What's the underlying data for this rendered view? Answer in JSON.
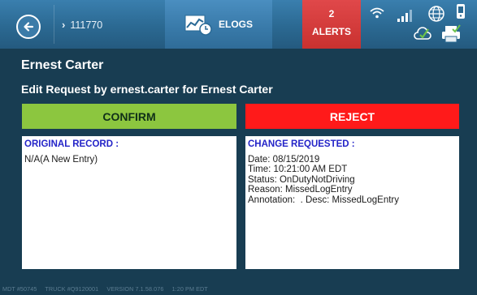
{
  "topbar": {
    "vehicle_id": "111770",
    "elogs_label": "ELOGS",
    "alerts_count": "2",
    "alerts_label": "ALERTS"
  },
  "page": {
    "driver_name": "Ernest Carter",
    "subtitle": "Edit Request by ernest.carter for Ernest Carter"
  },
  "actions": {
    "confirm_label": "CONFIRM",
    "reject_label": "REJECT"
  },
  "original": {
    "title": "ORIGINAL RECORD :",
    "lines": [
      "N/A(A New Entry)"
    ]
  },
  "change": {
    "title": "CHANGE REQUESTED :",
    "lines": [
      "Date: 08/15/2019",
      "Time: 10:21:00 AM EDT",
      "Status: OnDutyNotDriving",
      "Reason: MissedLogEntry",
      "Annotation:  . Desc: MissedLogEntry"
    ]
  },
  "footer": {
    "mdt": "MDT #50745",
    "truck": "TRUCK #Q9120001",
    "version": "VERSION  7.1.58.076",
    "time": "1:20 PM EDT"
  },
  "colors": {
    "background": "#183d52",
    "topbar": "#2b6992",
    "confirm": "#8cc63f",
    "reject": "#ff1a1a",
    "alerts": "#d23a3a",
    "panel_title": "#2424c8"
  },
  "icons": [
    "back-arrow-icon",
    "chevron-right-icon",
    "elogs-chart-icon",
    "wifi-icon",
    "signal-bars-icon",
    "globe-icon",
    "phone-icon",
    "cloud-check-icon",
    "printer-icon"
  ]
}
